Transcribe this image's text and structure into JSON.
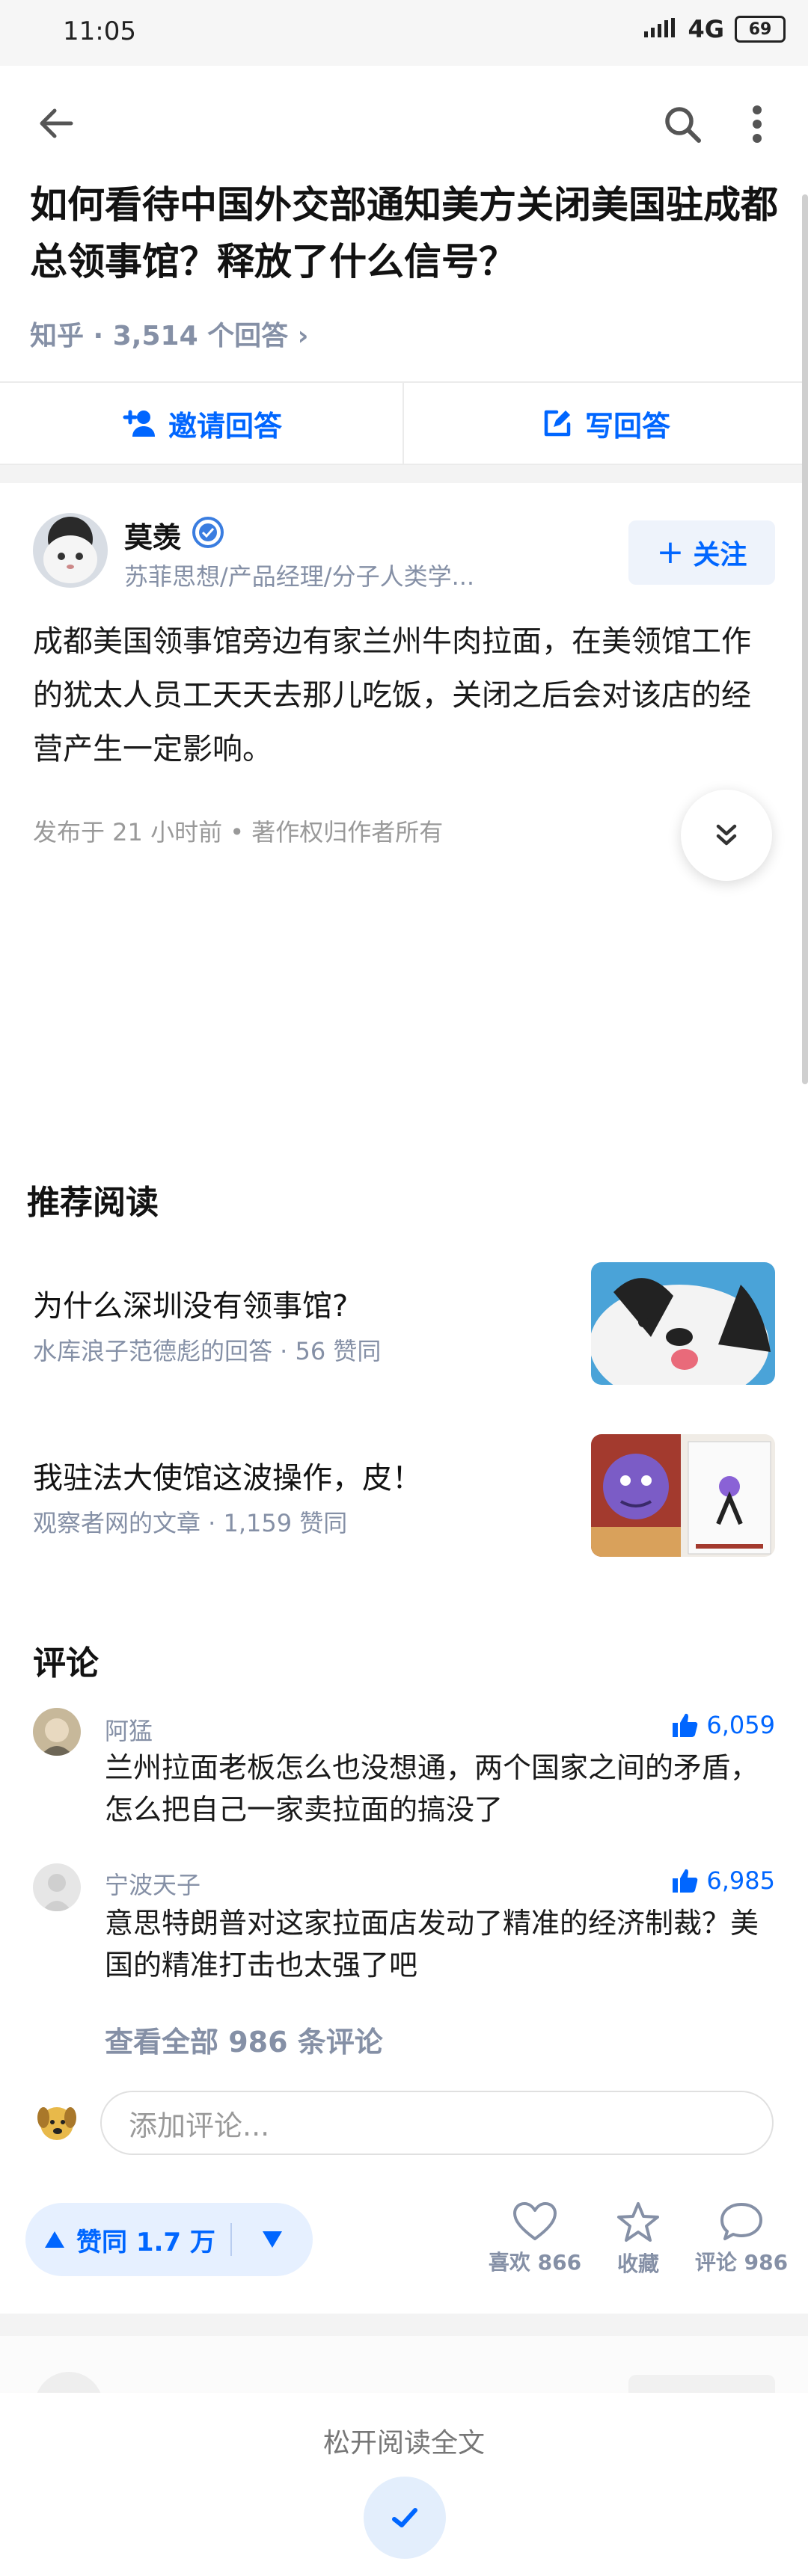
{
  "status": {
    "time": "11:05",
    "network": "4G",
    "battery": "69"
  },
  "question": {
    "title": "如何看待中国外交部通知美方关闭美国驻成都总领事馆？释放了什么信号？",
    "meta": "知乎 · 3,514 个回答 ›"
  },
  "actions": {
    "invite": "邀请回答",
    "write": "写回答"
  },
  "answer": {
    "author_name": "莫羡",
    "author_desc": "苏菲思想/产品经理/分子人类学...",
    "follow_label": "关注",
    "content": "成都美国领事馆旁边有家兰州牛肉拉面，在美领馆工作的犹太人员工天天去那儿吃饭，关闭之后会对该店的经营产生一定影响。",
    "published": "发布于 21 小时前 • 著作权归作者所有"
  },
  "recommended": {
    "heading": "推荐阅读",
    "items": [
      {
        "title": "为什么深圳没有领事馆?",
        "sub": "水库浪子范德彪的回答 · 56 赞同"
      },
      {
        "title": "我驻法大使馆这波操作，皮！",
        "sub": "观察者网的文章 · 1,159 赞同"
      }
    ]
  },
  "comments": {
    "heading": "评论",
    "items": [
      {
        "name": "阿猛",
        "likes": "6,059",
        "text": "兰州拉面老板怎么也没想通，两个国家之间的矛盾，怎么把自己一家卖拉面的搞没了"
      },
      {
        "name": "宁波天子",
        "likes": "6,985",
        "text": "意思特朗普对这家拉面店发动了精准的经济制裁？美国的精准打击也太强了吧"
      }
    ],
    "view_all": "查看全部 986 条评论",
    "input_placeholder": "添加评论..."
  },
  "bottom": {
    "vote_label": "赞同 1.7 万",
    "like_label": "喜欢 866",
    "fav_label": "收藏",
    "comment_label": "评论 986"
  },
  "release_text": "松开阅读全文",
  "colors": {
    "accent": "#0066ff",
    "muted": "#8590a6"
  }
}
